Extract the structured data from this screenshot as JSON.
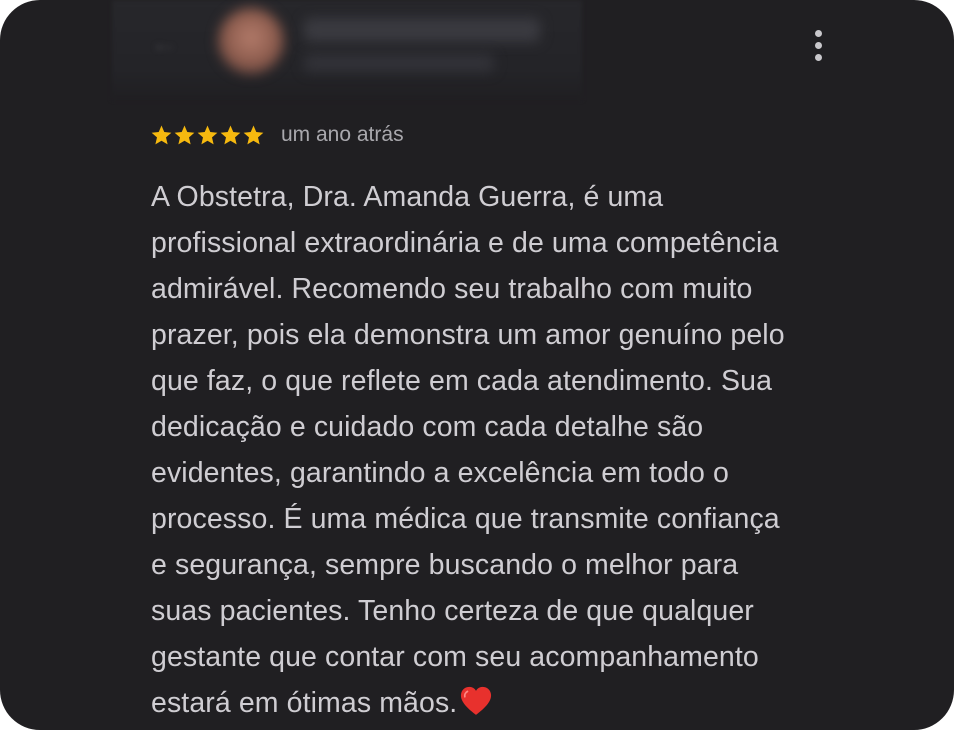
{
  "review": {
    "rating": 5,
    "rating_max": 5,
    "time_ago": "um ano atrás",
    "text": "A Obstetra, Dra. Amanda Guerra, é uma\nprofissional extraordinária e de uma competência\nadmirável. Recomendo seu trabalho com muito\nprazer, pois ela demonstra um amor genuíno pelo\nque faz, o que reflete em cada atendimento. Sua\ndedicação e cuidado com cada detalhe são\nevidentes, garantindo a excelência em todo o\nprocesso. É uma médica que transmite confiança\ne segurança, sempre buscando o melhor para\nsuas pacientes. Tenho certeza de que qualquer\ngestante que contar com seu acompanhamento\nestará em ótimas mãos.",
    "emoji": "heart-emoji"
  },
  "icons": {
    "star": "star-icon",
    "menu": "more-vertical-icon",
    "back": "back-arrow-icon"
  },
  "colors": {
    "background": "#201f22",
    "star": "#f6b90f",
    "text": "#cfcdd2",
    "muted": "#a9a8ad",
    "heart": "#e8312d"
  }
}
